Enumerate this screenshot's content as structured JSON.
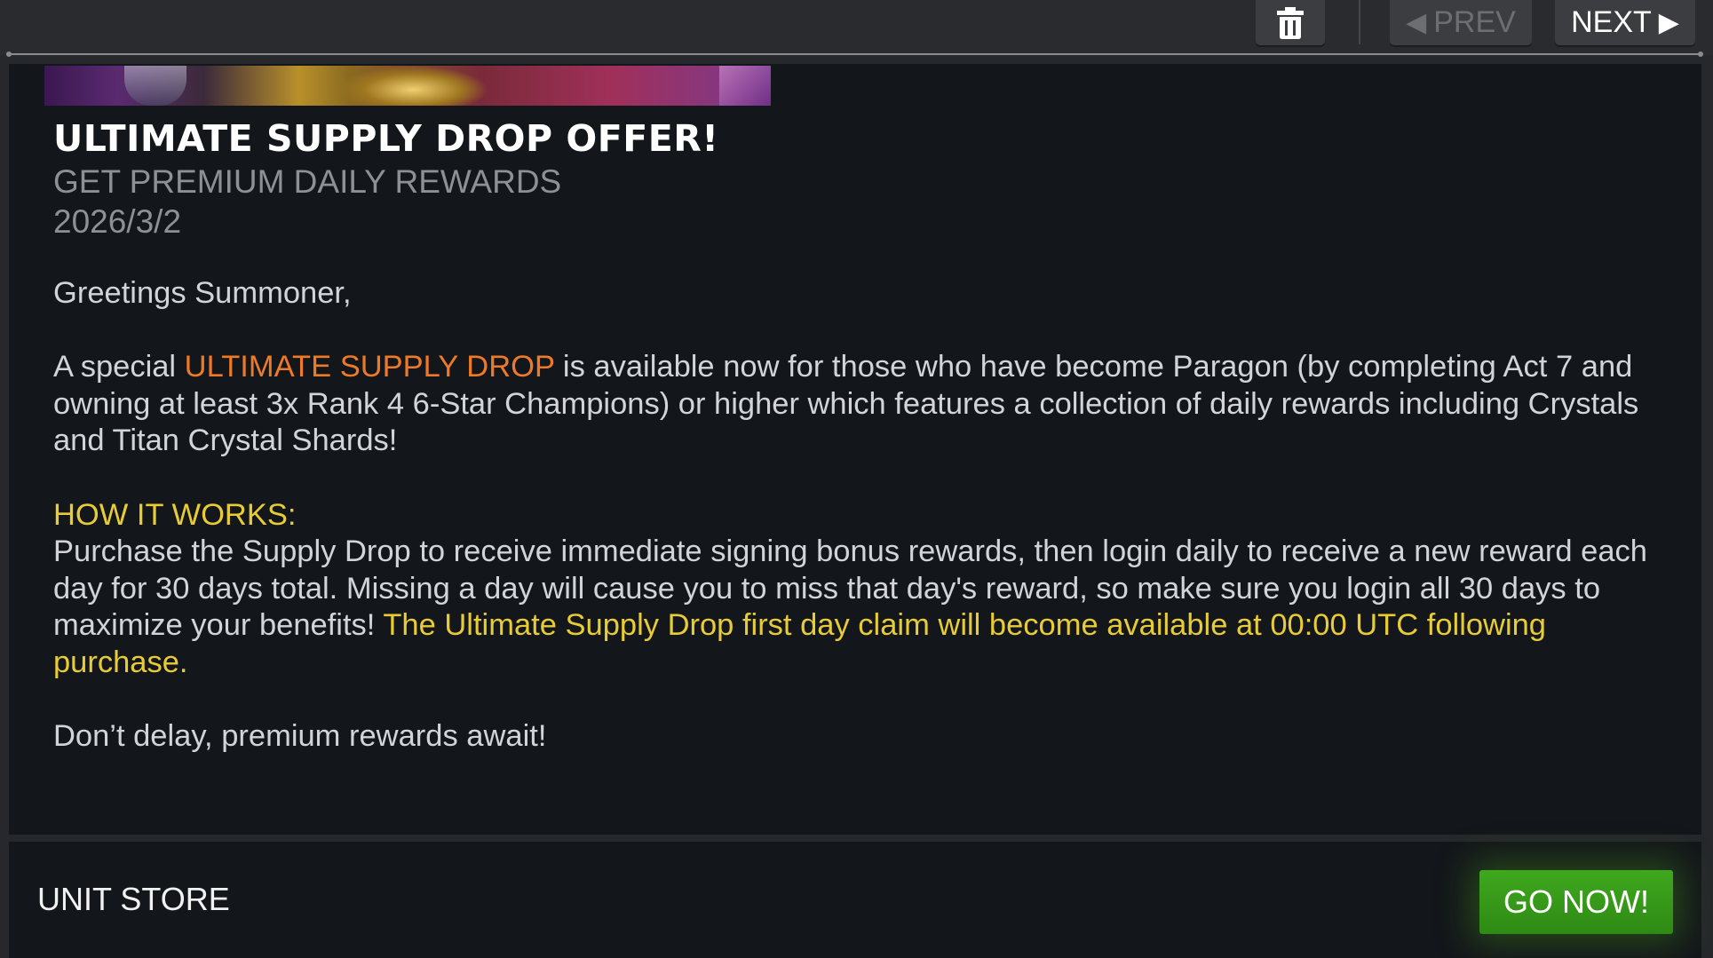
{
  "toolbar": {
    "delete_icon": "trash-icon",
    "prev_label": "PREV",
    "prev_icon": "triangle-left-icon",
    "next_label": "NEXT",
    "next_icon": "triangle-right-icon"
  },
  "message": {
    "title": "ULTIMATE SUPPLY DROP OFFER!",
    "subtitle": "GET PREMIUM DAILY REWARDS",
    "date": "2026/3/2",
    "greeting": "Greetings Summoner,",
    "para1_lead": "A special ",
    "para1_highlight": "ULTIMATE SUPPLY DROP",
    "para1_rest": " is available now for those who have become Paragon (by completing Act 7 and owning at least 3x Rank 4 6-Star Champions) or higher which features a collection of daily rewards including Crystals and Titan Crystal Shards!",
    "how_heading": "HOW IT WORKS:",
    "how_text": "Purchase the Supply Drop to receive immediate signing bonus rewards, then login daily to receive a new reward each day for 30 days total. Missing a day will cause you to miss that day's reward, so make sure you login all 30 days to maximize your benefits! ",
    "how_highlight": "The Ultimate Supply Drop first day claim will become available at 00:00 UTC following purchase.",
    "closing": "Don’t delay, premium rewards await!"
  },
  "footer": {
    "label": "UNIT STORE",
    "button_label": "GO NOW!"
  },
  "colors": {
    "highlight_orange": "#ee7a28",
    "highlight_yellow": "#e8cc36",
    "go_button_green": "#3fa81e"
  }
}
